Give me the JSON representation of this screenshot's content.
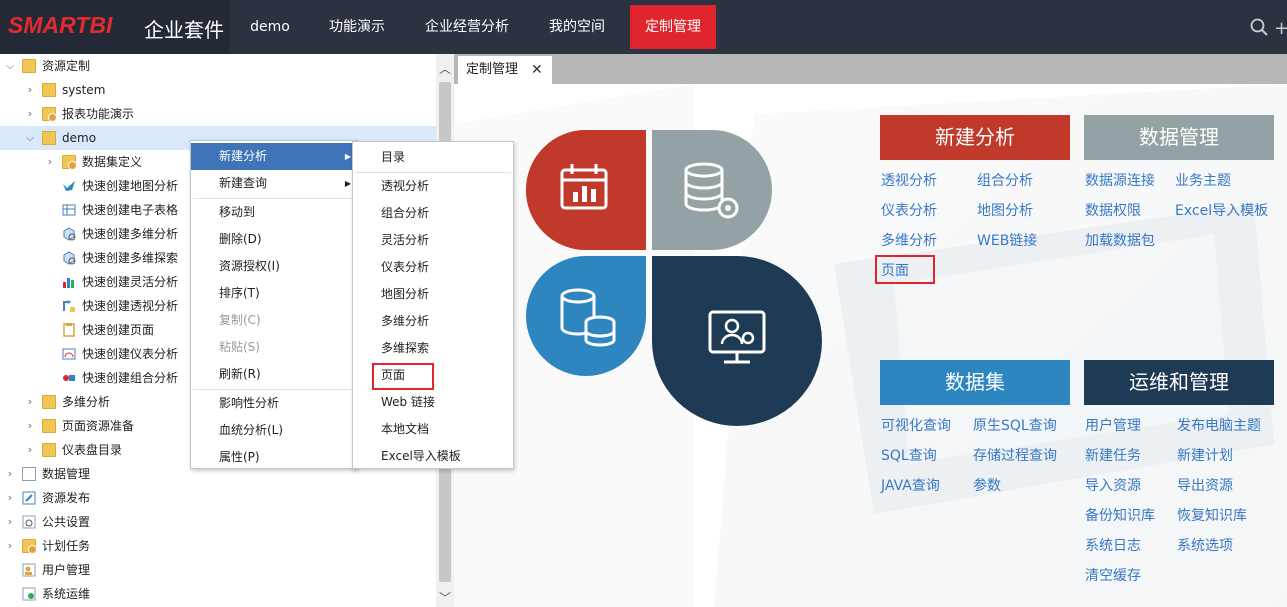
{
  "header": {
    "brand": "SMARTBI",
    "brand_suffix": "企业套件",
    "nav": [
      "demo",
      "功能演示",
      "企业经营分析",
      "我的空间",
      "定制管理"
    ],
    "active_nav": "定制管理"
  },
  "tree": {
    "root": "资源定制",
    "children": [
      "system",
      "报表功能演示",
      "demo"
    ],
    "demo_children": [
      "数据集定义",
      "快速创建地图分析",
      "快速创建电子表格",
      "快速创建多维分析",
      "快速创建多维探索",
      "快速创建灵活分析",
      "快速创建透视分析",
      "快速创建页面",
      "快速创建仪表分析",
      "快速创建组合分析"
    ],
    "after_demo": [
      "多维分析",
      "页面资源准备",
      "仪表盘目录"
    ],
    "top_level": [
      "数据管理",
      "资源发布",
      "公共设置",
      "计划任务",
      "用户管理",
      "系统运维"
    ]
  },
  "context_menu": {
    "items": [
      "新建分析",
      "新建查询",
      "移动到",
      "删除(D)",
      "资源授权(I)",
      "排序(T)",
      "复制(C)",
      "粘贴(S)",
      "刷新(R)",
      "影响性分析",
      "血统分析(L)",
      "属性(P)"
    ],
    "highlighted": "新建分析",
    "disabled": [
      "复制(C)",
      "粘贴(S)"
    ]
  },
  "submenu": {
    "items": [
      "目录",
      "透视分析",
      "组合分析",
      "灵活分析",
      "仪表分析",
      "地图分析",
      "多维分析",
      "多维探索",
      "页面",
      "Web 链接",
      "本地文档",
      "Excel导入模板"
    ],
    "boxed": "页面"
  },
  "tab": {
    "label": "定制管理",
    "close": "✕"
  },
  "cards": {
    "new_analysis": {
      "title": "新建分析",
      "color": "#c0392b",
      "links": [
        "透视分析",
        "组合分析",
        "仪表分析",
        "地图分析",
        "多维分析",
        "WEB链接",
        "页面"
      ],
      "boxed": "页面"
    },
    "data_management": {
      "title": "数据管理",
      "color": "#95a2a5",
      "links": [
        "数据源连接",
        "业务主题",
        "数据权限",
        "Excel导入模板",
        "加载数据包"
      ]
    },
    "dataset": {
      "title": "数据集",
      "color": "#2e86c1",
      "links": [
        "可视化查询",
        "原生SQL查询",
        "SQL查询",
        "存储过程查询",
        "JAVA查询",
        "参数"
      ]
    },
    "ops": {
      "title": "运维和管理",
      "color": "#1f3a54",
      "links": [
        "用户管理",
        "发布电脑主题",
        "新建任务",
        "新建计划",
        "导入资源",
        "导出资源",
        "备份知识库",
        "恢复知识库",
        "系统日志",
        "系统选项",
        "清空缓存"
      ]
    }
  },
  "colors": {
    "topbar": "#2b3240",
    "accent_red": "#e0262c",
    "link_blue": "#3778c7",
    "petal_red": "#c0392b",
    "petal_gray": "#95a2a5",
    "petal_blue": "#2e86c1",
    "petal_navy": "#1f3a54"
  }
}
